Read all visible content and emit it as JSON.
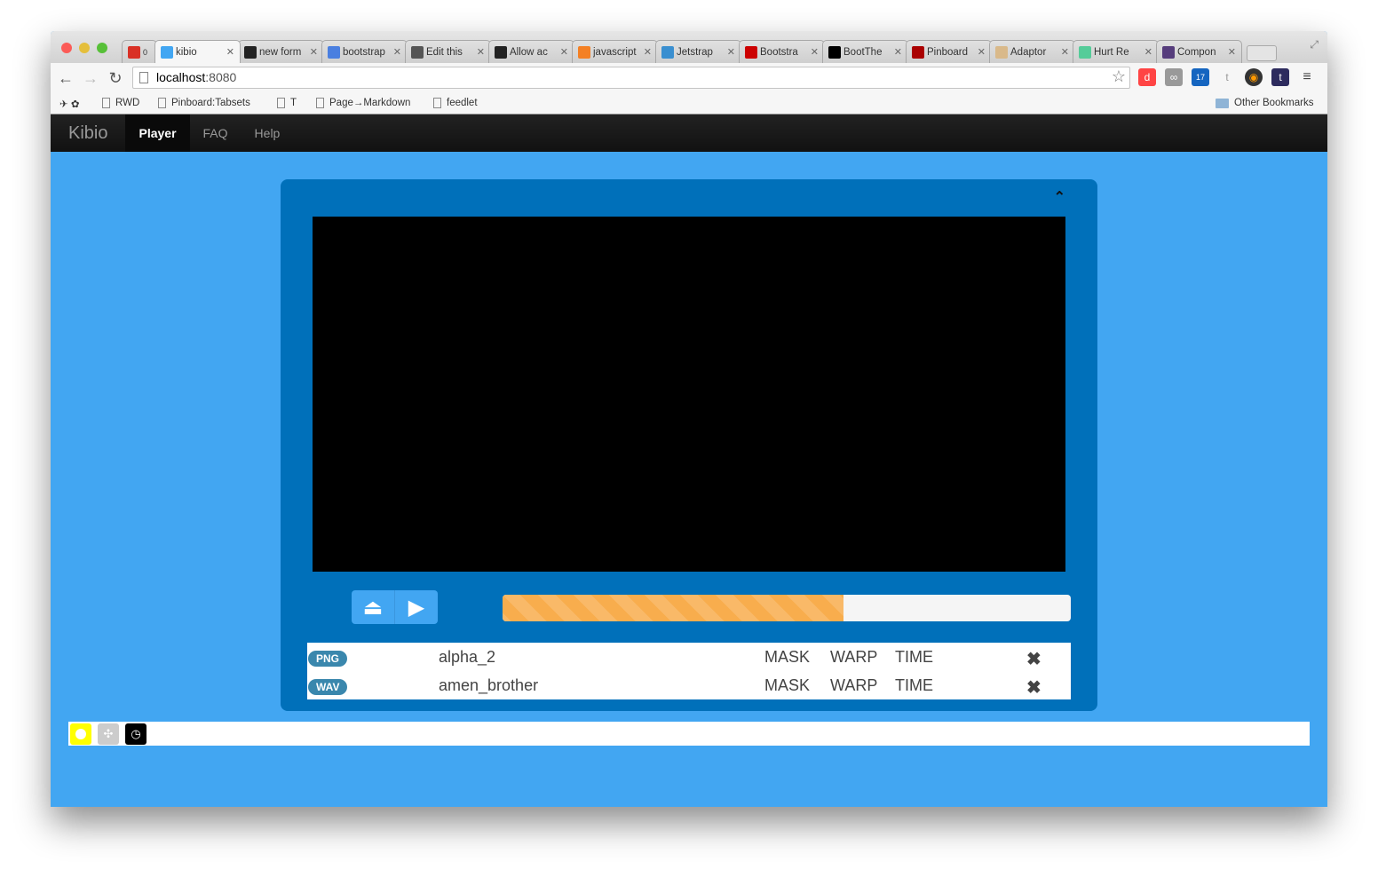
{
  "browser": {
    "tabs": [
      {
        "title": "",
        "icon": "gmail-icon",
        "badge": "0",
        "color": "#d93025"
      },
      {
        "title": "kibio",
        "icon": "kibio-icon",
        "color": "#42a6f2",
        "active": true
      },
      {
        "title": "new form",
        "icon": "github-icon",
        "color": "#222"
      },
      {
        "title": "bootstrap",
        "icon": "google-icon",
        "color": "#4a7fe0"
      },
      {
        "title": "Edit this",
        "icon": "cloud-icon",
        "color": "#555"
      },
      {
        "title": "Allow ac",
        "icon": "github-icon",
        "color": "#222"
      },
      {
        "title": "javascript",
        "icon": "stackoverflow-icon",
        "color": "#f48024"
      },
      {
        "title": "Jetstrap",
        "icon": "jetstrap-icon",
        "color": "#3a8fd0"
      },
      {
        "title": "Bootstra",
        "icon": "bootstrap-icon",
        "color": "#c00"
      },
      {
        "title": "BootThe",
        "icon": "boottheme-icon",
        "color": "#000"
      },
      {
        "title": "Pinboard",
        "icon": "pinboard-icon",
        "color": "#a00"
      },
      {
        "title": "Adaptor",
        "icon": "adaptor-icon",
        "color": "#d9b98a"
      },
      {
        "title": "Hurt Re",
        "icon": "hurt-icon",
        "color": "#5c9"
      },
      {
        "title": "Compon",
        "icon": "bootstrap-b-icon",
        "color": "#563d7c"
      }
    ],
    "url_host": "localhost",
    "url_port": ":8080",
    "bookmarks": [
      "RWD",
      "Pinboard:Tabsets",
      "T",
      "Page→Markdown",
      "feedlet"
    ],
    "other_bookmarks": "Other Bookmarks"
  },
  "navbar": {
    "brand": "Kibio",
    "links": [
      "Player",
      "FAQ",
      "Help"
    ],
    "active": "Player"
  },
  "player": {
    "progress_percent": 60,
    "accent": "#f8ad4d",
    "files": [
      {
        "type": "PNG",
        "name": "alpha_2",
        "mask": "MASK",
        "warp": "WARP",
        "time": "TIME"
      },
      {
        "type": "WAV",
        "name": "amen_brother",
        "mask": "MASK",
        "warp": "WARP",
        "time": "TIME"
      }
    ]
  },
  "bottom_tools": [
    "circle-icon",
    "expand-icon",
    "clock-icon"
  ]
}
